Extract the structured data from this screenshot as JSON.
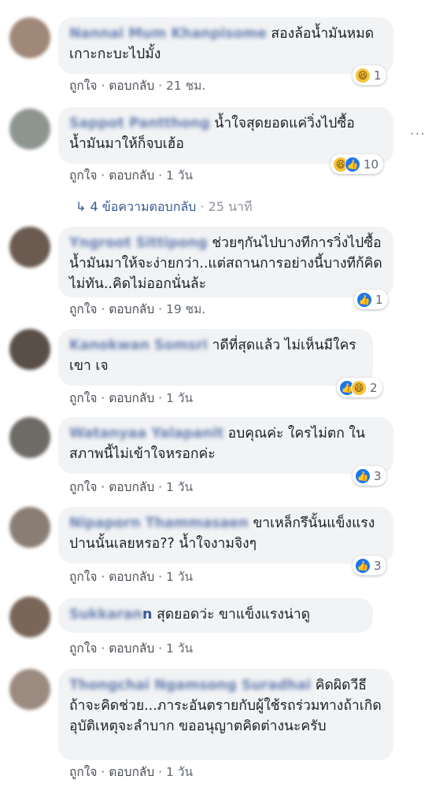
{
  "actions": {
    "like": "ถูกใจ",
    "reply": "ตอบกลับ",
    "sep": "·"
  },
  "comments": [
    {
      "author": "Nannai Mum Khanpisome",
      "text": "สองล้อน้ำมันหมด เกาะกะบะไปมั้ง",
      "time": "21 ชม.",
      "reactions": [
        "haha"
      ],
      "count": "1"
    },
    {
      "author": "Sappot Pantthong",
      "text": "น้ำใจสุดยอดแค่วิ่งไปซื้อน้ำมันมาให้ก็จบเฮ้อ",
      "time": "1 วัน",
      "reactions": [
        "haha",
        "like"
      ],
      "count": "10"
    },
    {
      "author": "Yngroot Sittipong",
      "text": "ช่วยๆกันไปบางทีการวิ่งไปซื้อน้ำมันมาให้จะง่ายกว่า..แต่สถานการอย่างนี้บางทีก้คิดไม่ทัน..คิดไม่ออกนั่นล้ะ",
      "time": "19 ชม.",
      "reactions": [
        "like"
      ],
      "count": "1"
    },
    {
      "author": "Kanokwan Somsri",
      "text": "าดีที่สุดแล้ว ไม่เห็นมีใครเขา เจ",
      "time": "1 วัน",
      "reactions": [
        "like",
        "haha"
      ],
      "count": "2"
    },
    {
      "author": "Watanyaa Yalapanit",
      "text": "อบคุณค่ะ ใครไม่ตก ในสภาพนี้ไม่เข้าใจหรอกค่ะ",
      "time": "1 วัน",
      "reactions": [
        "like"
      ],
      "count": "3"
    },
    {
      "author": "Nipaporn Thammasaen",
      "text": "ขาเหล็กรึนั้นแข็งแรงปานนั้นเลยหรอ?? น้ำใจงามจิงๆ",
      "time": "1 วัน",
      "reactions": [
        "like"
      ],
      "count": "3"
    },
    {
      "author": "Sukkaran",
      "author_tail": "n",
      "text": "สุดยอดว่ะ ขาแข็งแรงน่าดู",
      "time": "1 วัน"
    },
    {
      "author": "Thongchai Ngamsong Suradhai",
      "text": "คิดผิดวีธีถ้าจะคิดช่วย...ภาระอันตรายกับผู้ใช้รถร่วมทางถ้าเกิดอุบัติเหตุจะลำบาก ขออนุญาตคิดต่างนะครับ",
      "time": "1 วัน"
    }
  ],
  "replies_row": {
    "icon": "reply-arrow-icon",
    "text": "4 ข้อความตอบกลับ",
    "time": "25 นาที"
  },
  "more_icon": "more-dots-icon",
  "colors": {
    "link": "#385898",
    "bubble": "#f2f3f5",
    "like": "#1877f2",
    "haha": "#f7c33c"
  }
}
